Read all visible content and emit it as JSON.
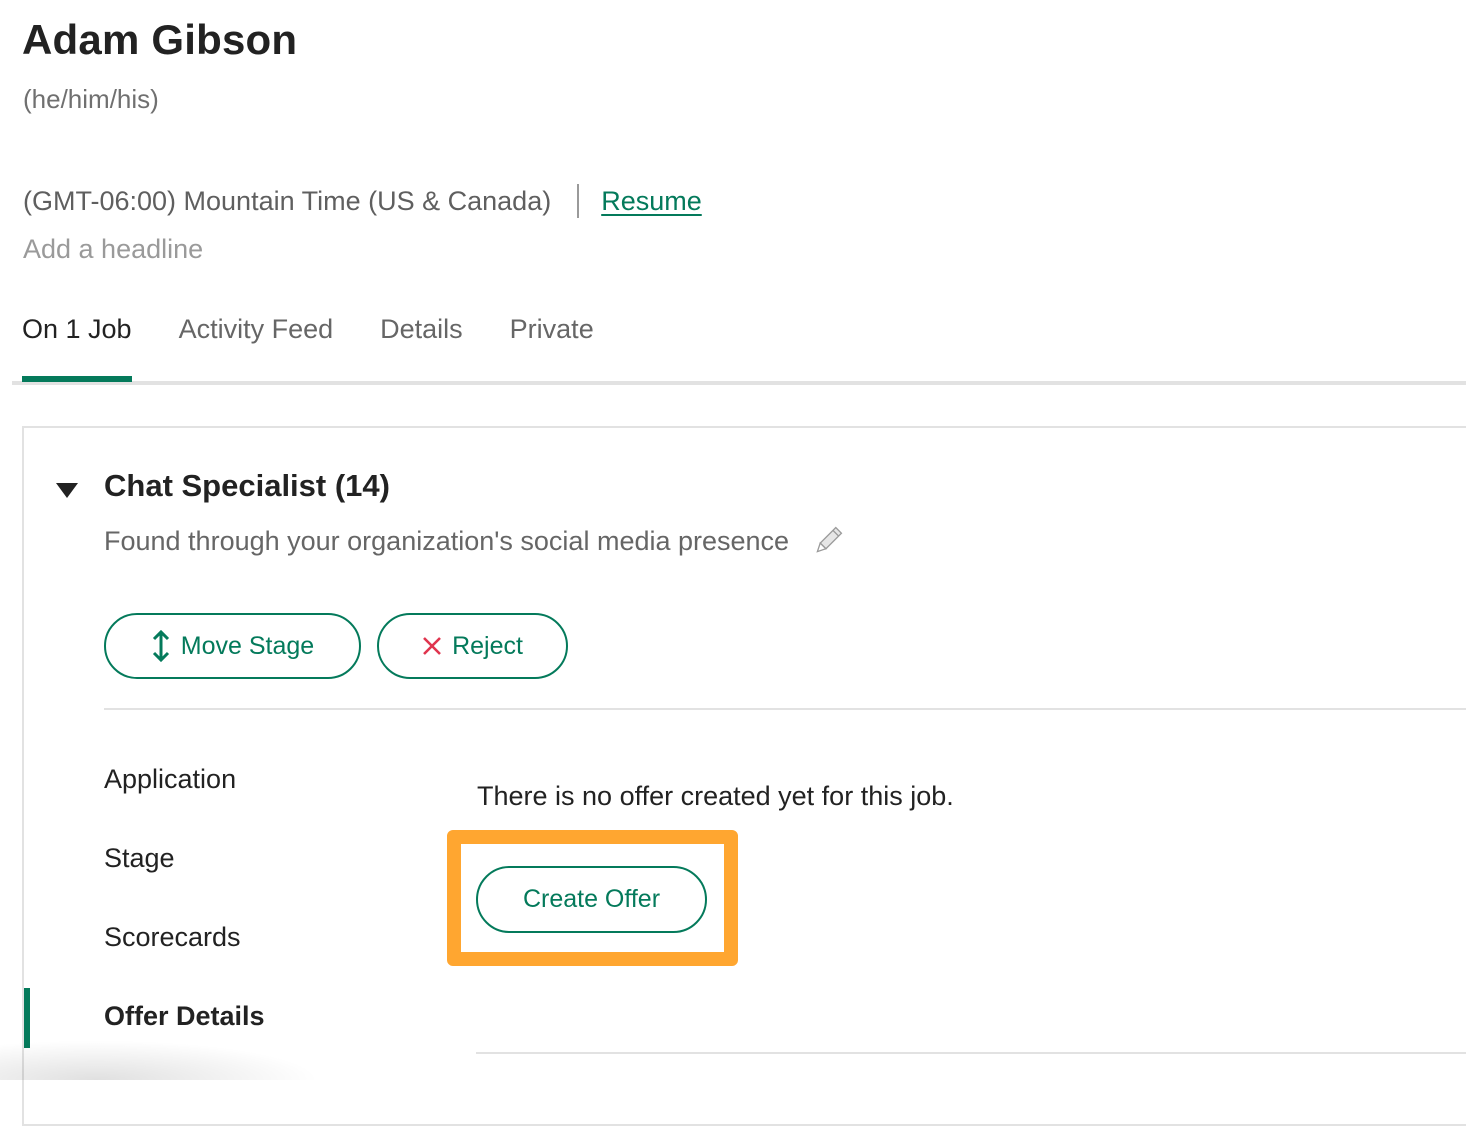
{
  "candidate": {
    "name": "Adam Gibson",
    "pronouns": "(he/him/his)",
    "timezone": "(GMT-06:00) Mountain Time (US & Canada)",
    "resume_link": "Resume",
    "headline_placeholder": "Add a headline"
  },
  "tabs": [
    {
      "label": "On 1 Job",
      "active": true
    },
    {
      "label": "Activity Feed",
      "active": false
    },
    {
      "label": "Details",
      "active": false
    },
    {
      "label": "Private",
      "active": false
    }
  ],
  "job": {
    "title": "Chat Specialist (14)",
    "source": "Found through your organization's social media presence",
    "actions": {
      "move_stage": "Move Stage",
      "reject": "Reject"
    }
  },
  "side_nav": [
    {
      "label": "Application",
      "active": false
    },
    {
      "label": "Stage",
      "active": false
    },
    {
      "label": "Scorecards",
      "active": false
    },
    {
      "label": "Offer Details",
      "active": true
    }
  ],
  "offer": {
    "message": "There is no offer created yet for this job.",
    "create_button": "Create Offer"
  },
  "icons": {
    "caret": "caret-down-icon",
    "pencil": "pencil-icon",
    "move": "vertical-arrows-icon",
    "reject": "x-icon"
  },
  "colors": {
    "accent": "#047a5b",
    "reject": "#e0344e",
    "highlight": "#ffa630",
    "border": "#e2e2e2"
  }
}
